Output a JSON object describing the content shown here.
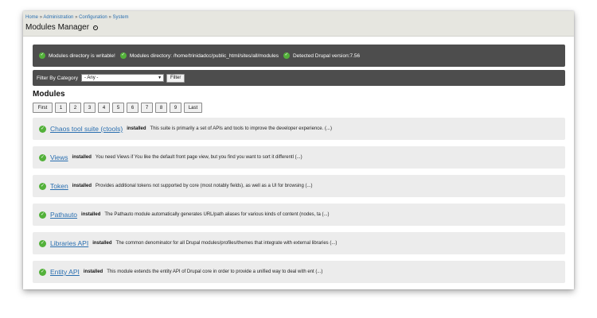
{
  "breadcrumb": [
    "Home",
    "Administration",
    "Configuration",
    "System"
  ],
  "breadcrumb_separator": "»",
  "page_title": "Modules Manager",
  "status_bar": [
    {
      "text": "Modules directory is writable!"
    },
    {
      "text": "Modules directory: /home/trinidadcc/public_html/sites/all/modules"
    },
    {
      "text": "Detected Drupal version:7.56"
    }
  ],
  "filter": {
    "label": "Filter By Category",
    "selected": "- Any -",
    "button": "Filter"
  },
  "section_title": "Modules",
  "pager": {
    "first": "First",
    "pages": [
      "1",
      "2",
      "3",
      "4",
      "5",
      "6",
      "7",
      "8",
      "9"
    ],
    "last": "Last"
  },
  "modules": [
    {
      "name": "Chaos tool suite (ctools)",
      "status": "installed",
      "description": "This suite is primarily a set of APIs and tools to improve the developer experience. (...)"
    },
    {
      "name": "Views",
      "status": "installed",
      "description": "You need Views if You like the default front page view, but you find you want to sort it differentl (...)"
    },
    {
      "name": "Token",
      "status": "installed",
      "description": "Provides additional tokens not supported by core (most notably fields), as well as a UI for browsing (...)"
    },
    {
      "name": "Pathauto",
      "status": "installed",
      "description": "The Pathauto module automatically generates URL/path aliases for various kinds of content (nodes, ta (...)"
    },
    {
      "name": "Libraries API",
      "status": "installed",
      "description": "The common denominator for all Drupal modules/profiles/themes that integrate with external libraries (...)"
    },
    {
      "name": "Entity API",
      "status": "installed",
      "description": "This module extends the entity API of Drupal core in order to provide a unified way to deal with ent (...)"
    }
  ],
  "icons": {
    "check": "check-circle-icon",
    "settings": "gear-icon"
  },
  "colors": {
    "link": "#2a6fb0",
    "status_bar_bg": "#4d4d4d",
    "check_green": "#53b13a",
    "module_row_bg": "#ececec"
  }
}
